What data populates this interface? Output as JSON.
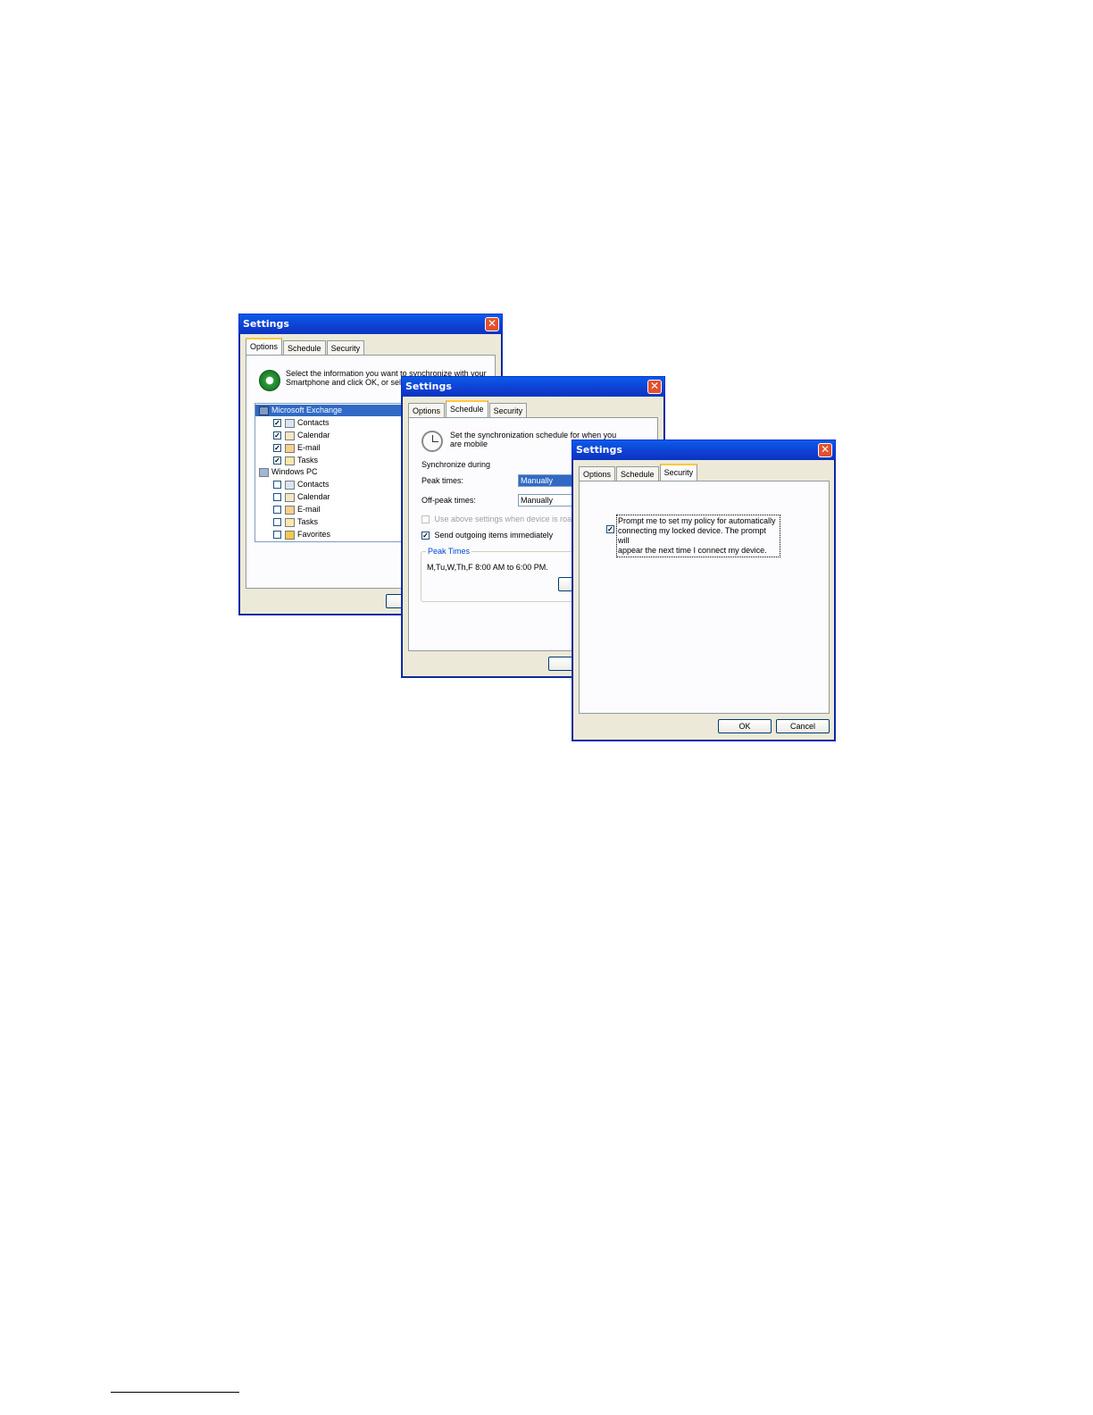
{
  "windows": {
    "options": {
      "title": "Settings",
      "tabs": [
        "Options",
        "Schedule",
        "Security"
      ],
      "intro": "Select the information you want to synchronize with your Smartphone and click OK, or select Settings.",
      "groups": [
        {
          "name": "Microsoft Exchange",
          "items": [
            {
              "label": "Contacts",
              "checked": true
            },
            {
              "label": "Calendar",
              "checked": true
            },
            {
              "label": "E-mail",
              "checked": true
            },
            {
              "label": "Tasks",
              "checked": true
            }
          ]
        },
        {
          "name": "Windows PC",
          "items": [
            {
              "label": "Contacts",
              "checked": false
            },
            {
              "label": "Calendar",
              "checked": false
            },
            {
              "label": "E-mail",
              "checked": false
            },
            {
              "label": "Tasks",
              "checked": false
            },
            {
              "label": "Favorites",
              "checked": false
            }
          ]
        }
      ]
    },
    "schedule": {
      "title": "Settings",
      "tabs": [
        "Options",
        "Schedule",
        "Security"
      ],
      "intro": "Set the synchronization schedule for when you are mobile",
      "sync_during": "Synchronize during",
      "peak_label": "Peak times:",
      "peak_value": "Manually",
      "offpeak_label": "Off-peak times:",
      "offpeak_value": "Manually",
      "roaming_label": "Use above settings when device is roami",
      "send_label": "Send outgoing items immediately",
      "peak_group_title": "Peak Times",
      "peak_group_text": "M,Tu,W,Th,F 8:00 AM to 6:00 PM."
    },
    "security": {
      "title": "Settings",
      "tabs": [
        "Options",
        "Schedule",
        "Security"
      ],
      "prompt_line1": "Prompt me to set my policy for automatically",
      "prompt_line2": "connecting my locked device. The prompt will",
      "prompt_line3": "appear the next time I connect my device.",
      "ok": "OK",
      "cancel": "Cancel"
    }
  }
}
